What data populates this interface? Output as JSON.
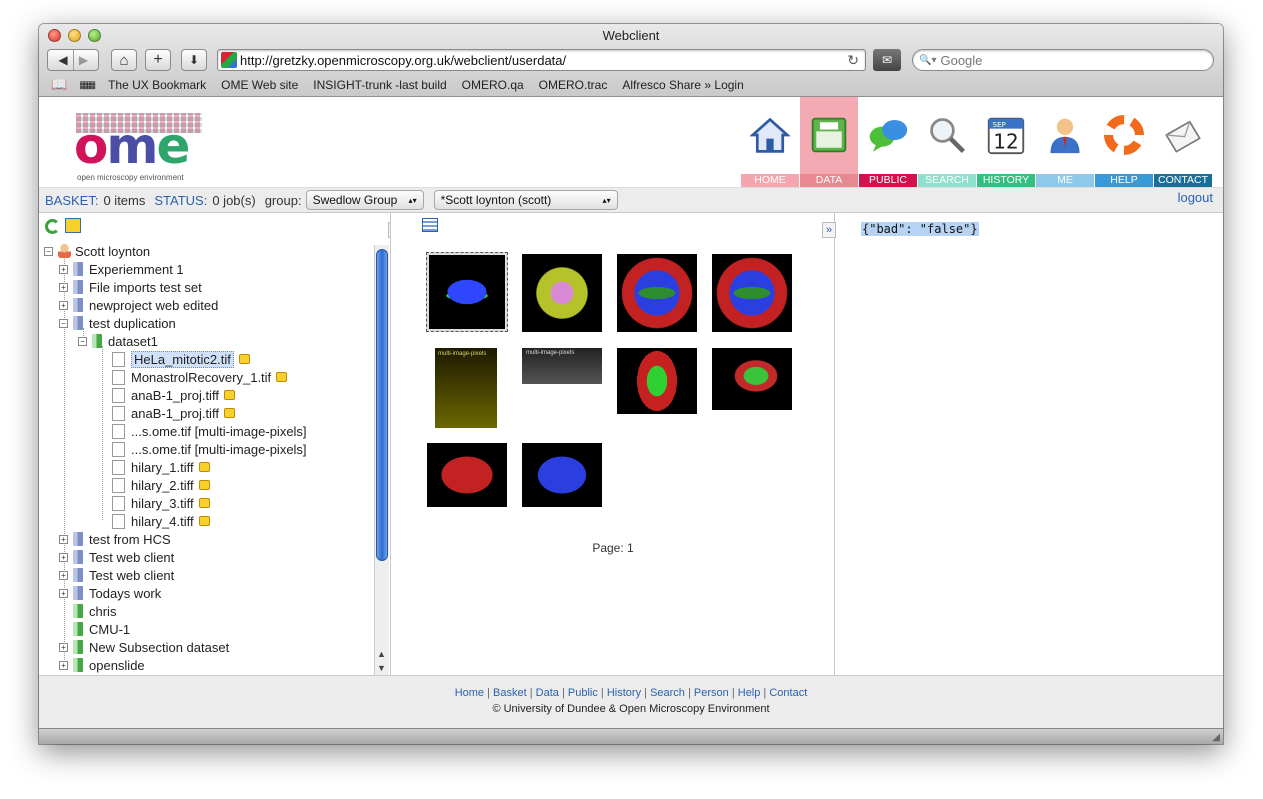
{
  "window": {
    "title": "Webclient"
  },
  "toolbar": {
    "back_glyph": "◀",
    "forward_glyph": "▶",
    "home_glyph": "⌂",
    "add_glyph": "+",
    "download_glyph": "⬇",
    "url": "http://gretzky.openmicroscopy.org.uk/webclient/userdata/",
    "reload_glyph": "↻",
    "search_placeholder": "Google",
    "search_glyph": "🔍▾"
  },
  "bookmarks": [
    "The UX Bookmark",
    "OME Web site",
    "INSIGHT-trunk -last build",
    "OMERO.qa",
    "OMERO.trac",
    "Alfresco Share » Login"
  ],
  "app": {
    "logo_sub": "open microscopy environment",
    "nav": [
      {
        "label": "HOME",
        "color": "#f4a5ae"
      },
      {
        "label": "DATA",
        "color": "#e98890"
      },
      {
        "label": "PUBLIC",
        "color": "#d1124c"
      },
      {
        "label": "SEARCH",
        "color": "#8fe0cc"
      },
      {
        "label": "HISTORY",
        "color": "#32c082"
      },
      {
        "label": "ME",
        "color": "#8ec9ec"
      },
      {
        "label": "HELP",
        "color": "#3a9ad8"
      },
      {
        "label": "CONTACT",
        "color": "#1a6f98"
      }
    ]
  },
  "status": {
    "basket_label": "BASKET:",
    "basket_value": "0 items",
    "status_label": "STATUS:",
    "status_value": "0 job(s)",
    "group_label": "group:",
    "group_value": "Swedlow Group",
    "user_value": "*Scott loynton (scott)",
    "logout": "logout"
  },
  "tree": {
    "root": "Scott loynton",
    "projects_top": [
      "Experiemment 1",
      "File imports test set",
      "newproject web edited",
      "test duplication"
    ],
    "dataset": "dataset1",
    "images": [
      {
        "name": "HeLa_mitotic2.tif",
        "tag": true
      },
      {
        "name": "MonastrolRecovery_1.tif",
        "tag": true
      },
      {
        "name": "anaB-1_proj.tiff",
        "tag": true
      },
      {
        "name": "anaB-1_proj.tiff",
        "tag": true
      },
      {
        "name": "...s.ome.tif [multi-image-pixels]",
        "tag": false
      },
      {
        "name": "...s.ome.tif [multi-image-pixels]",
        "tag": false
      },
      {
        "name": "hilary_1.tiff",
        "tag": true
      },
      {
        "name": "hilary_2.tiff",
        "tag": true
      },
      {
        "name": "hilary_3.tiff",
        "tag": true
      },
      {
        "name": "hilary_4.tiff",
        "tag": true
      }
    ],
    "projects_bottom": [
      {
        "name": "test from HCS",
        "type": "project"
      },
      {
        "name": "Test web client",
        "type": "project"
      },
      {
        "name": "Test web client",
        "type": "project"
      },
      {
        "name": "Todays work",
        "type": "project"
      },
      {
        "name": "chris",
        "type": "dataset"
      },
      {
        "name": "CMU-1",
        "type": "dataset"
      },
      {
        "name": "New Subsection dataset",
        "type": "project"
      },
      {
        "name": "openslide",
        "type": "project"
      }
    ]
  },
  "center": {
    "page_label": "Page: 1",
    "multi_label": "multi-image-pixels"
  },
  "right": {
    "json_text": "{\"bad\": \"false\"}"
  },
  "footer": {
    "links": [
      "Home",
      "Basket",
      "Data",
      "Public",
      "History",
      "Search",
      "Person",
      "Help",
      "Contact"
    ],
    "copyright": "© University of Dundee & Open Microscopy Environment"
  }
}
